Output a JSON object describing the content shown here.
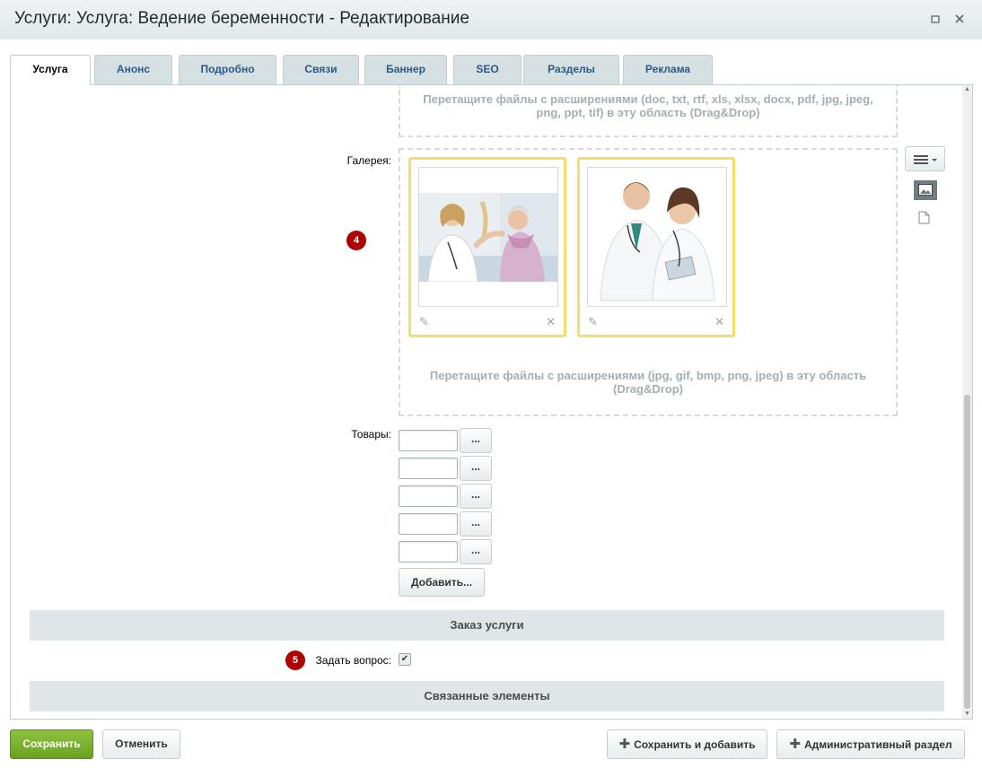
{
  "window": {
    "title": "Услуги: Услуга: Ведение беременности - Редактирование"
  },
  "tabs": [
    {
      "label": "Услуга"
    },
    {
      "label": "Анонс"
    },
    {
      "label": "Подробно"
    },
    {
      "label": "Связи"
    },
    {
      "label": "Баннер"
    },
    {
      "label": "SEO"
    },
    {
      "label": "Разделы"
    },
    {
      "label": "Реклама"
    }
  ],
  "files": {
    "dropzone_text": "Перетащите файлы с расширениями (doc, txt, rtf, xls, xlsx, docx, pdf, jpg, jpeg, png, ppt, tif) в эту область (Drag&Drop)"
  },
  "gallery": {
    "label": "Галерея:",
    "badge": "4",
    "dropzone_text": "Перетащите файлы с расширениями (jpg, gif, bmp, png, jpeg) в эту область (Drag&Drop)"
  },
  "products": {
    "label": "Товары:",
    "browse_label": "...",
    "add_label": "Добавить..."
  },
  "order": {
    "section_title": "Заказ услуги",
    "badge": "5",
    "ask_label": "Задать вопрос:",
    "ask_checked": true
  },
  "linked": {
    "section_title": "Связанные элементы"
  },
  "footer": {
    "save": "Сохранить",
    "cancel": "Отменить",
    "save_add": "Сохранить и добавить",
    "admin": "Административный раздел"
  },
  "colors": {
    "tab_text": "#2a5a86",
    "badge": "#b00000",
    "save_button": "#6aa321",
    "card_border": "#f5dd6a"
  }
}
